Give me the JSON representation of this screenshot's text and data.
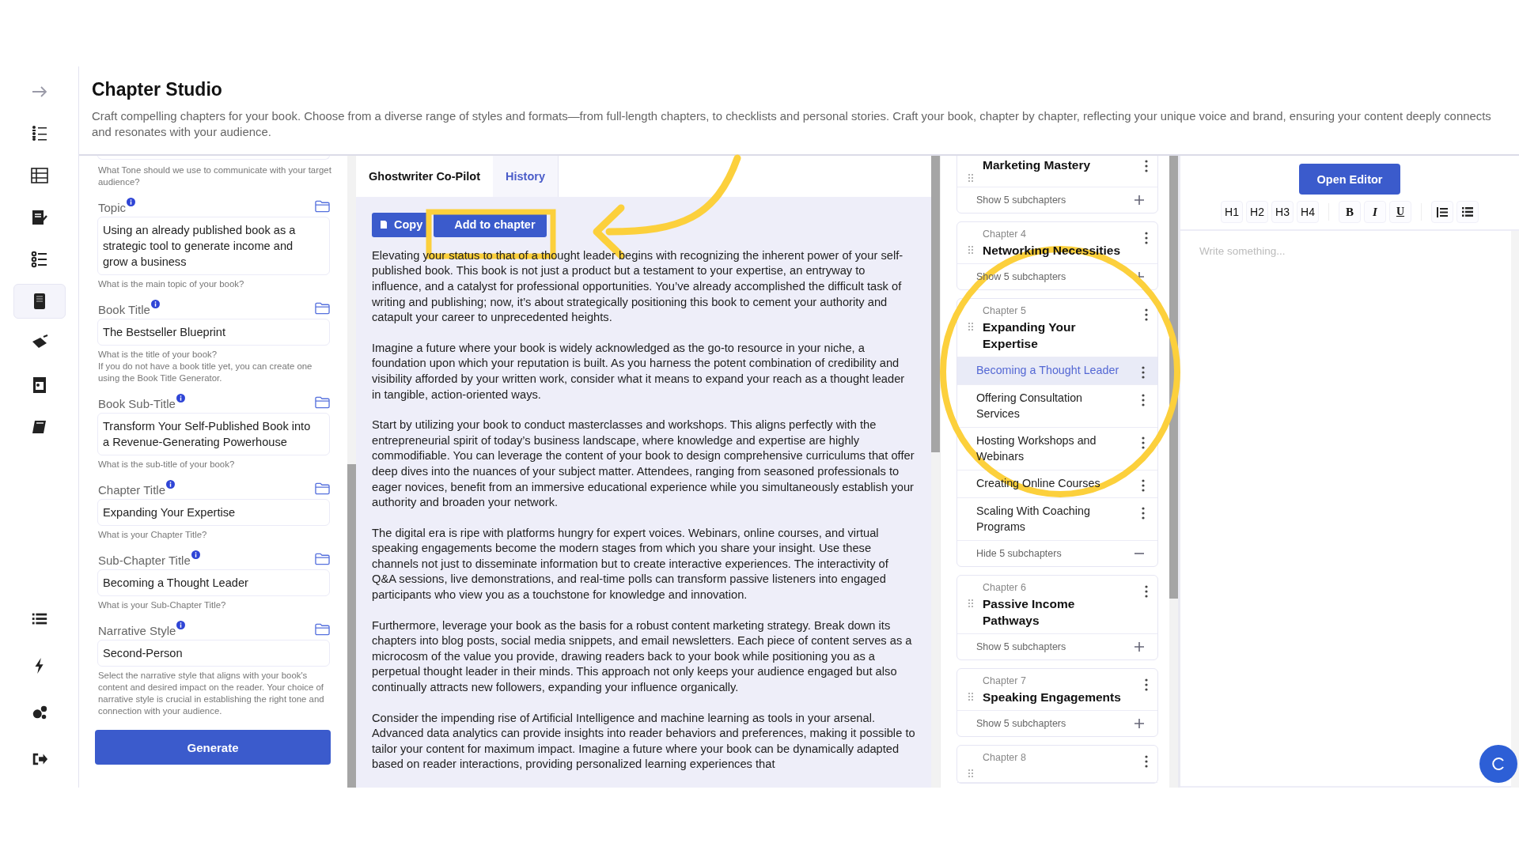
{
  "page": {
    "title": "Chapter Studio",
    "description": "Craft compelling chapters for your book. Choose from a diverse range of styles and formats—from full-length chapters, to checklists and personal stories. Craft your book, chapter by chapter, reflecting your unique voice and brand, ensuring your content deeply connects and resonates with your audience."
  },
  "nav": {
    "top": [
      {
        "selected": false
      },
      {
        "selected": false
      },
      {
        "selected": false
      },
      {
        "selected": false
      },
      {
        "selected": false
      },
      {
        "selected": true
      },
      {
        "selected": false
      },
      {
        "selected": false
      },
      {
        "selected": false
      }
    ],
    "bottom": [
      {
        "selected": false
      },
      {
        "selected": false
      },
      {
        "selected": false
      },
      {
        "selected": false
      }
    ]
  },
  "form": {
    "top_hint": "What Tone should we use to communicate with your target audience?",
    "fields": [
      {
        "label": "Topic",
        "value": "Using an already published book as a strategic tool to generate income and grow a business",
        "hint": "What is the main topic of your book?"
      },
      {
        "label": "Book Title",
        "value": "The Bestseller Blueprint",
        "hint": "What is the title of your book?\nIf you do not have a book title yet, you can create one using the Book Title Generator."
      },
      {
        "label": "Book Sub-Title",
        "value": "Transform Your Self-Published Book into a Revenue-Generating Powerhouse",
        "hint": "What is the sub-title of your book?"
      },
      {
        "label": "Chapter Title",
        "value": "Expanding Your Expertise",
        "hint": "What is your Chapter Title?"
      },
      {
        "label": "Sub-Chapter Title",
        "value": "Becoming a Thought Leader",
        "hint": "What is your Sub-Chapter Title?"
      },
      {
        "label": "Narrative Style",
        "value": "Second-Person",
        "hint": "Select the narrative style that aligns with your book's content and desired impact on the reader. Your choice of narrative style is crucial in establishing the right tone and connection with your audience."
      }
    ],
    "button": "Generate"
  },
  "copilot": {
    "tabs": [
      {
        "label": "Ghostwriter Co-Pilot",
        "selected": true
      },
      {
        "label": "History",
        "selected": false
      }
    ],
    "actions": [
      "Copy",
      "Add to chapter"
    ],
    "paragraphs": [
      "Elevating your status to that of a thought leader begins with recognizing the inherent power of your self-published book. This book is not just a product but a testament to your expertise, an entryway to influence, and a catalyst for professional opportunities. You’ve already accomplished the difficult task of writing and publishing; now, it’s about strategically positioning this book to cement your authority and catapult your career to unprecedented heights.",
      "Imagine a future where your book is widely acknowledged as the go-to resource in your niche, a foundation upon which your reputation is built. As you harness the potent combination of credibility and visibility afforded by your written work, consider what it means to expand your reach as a thought leader in tangible, action-oriented ways.",
      "Start by utilizing your book to conduct masterclasses and workshops. This aligns perfectly with the entrepreneurial spirit of today’s business landscape, where knowledge and expertise are highly commodifiable. You can leverage the content of your book to design comprehensive curriculums that offer deep dives into the nuances of your subject matter. Attendees, ranging from seasoned professionals to eager novices, benefit from an immersive educational experience while you simultaneously establish your authority and broaden your network.",
      "The digital era is ripe with platforms hungry for expert voices. Webinars, online courses, and virtual speaking engagements become the modern stages from which you share your insight. Use these channels not just to disseminate information but to create interactive experiences. The interactivity of Q&A sessions, live demonstrations, and real-time polls can transform passive listeners into engaged participants who view you as a touchstone for knowledge and innovation.",
      "Furthermore, leverage your book as the basis for a robust content marketing strategy. Break down its chapters into blog posts, social media snippets, and email newsletters. Each piece of content serves as a microcosm of the value you provide, drawing readers back to your book while positioning you as a perpetual thought leader in their minds. This approach not only keeps your audience engaged but also continually attracts new followers, expanding your influence organically.",
      "Consider the impending rise of Artificial Intelligence and machine learning as tools in your arsenal. Advanced data analytics can provide insights into reader behaviors and preferences, making it possible to tailor your content for maximum impact. Imagine a future where your book can be dynamically adapted based on reader interactions, providing personalized learning experiences that"
    ]
  },
  "chapters": [
    {
      "title": "Marketing Mastery",
      "expanded": false,
      "toggle": "Show 5 subchapters"
    },
    {
      "label": "Chapter 4",
      "title": "Networking Necessities",
      "expanded": false,
      "toggle": "Show 5 subchapters"
    },
    {
      "label": "Chapter 5",
      "title": "Expanding Your Expertise",
      "expanded": true,
      "toggle": "Hide 5 subchapters",
      "subchapters": [
        {
          "title": "Becoming a Thought Leader",
          "selected": true
        },
        {
          "title": "Offering Consultation Services",
          "selected": false
        },
        {
          "title": "Hosting Workshops and Webinars",
          "selected": false
        },
        {
          "title": "Creating Online Courses",
          "selected": false
        },
        {
          "title": "Scaling With Coaching Programs",
          "selected": false
        }
      ]
    },
    {
      "label": "Chapter 6",
      "title": "Passive Income Pathways",
      "expanded": false,
      "toggle": "Show 5 subchapters"
    },
    {
      "label": "Chapter 7",
      "title": "Speaking Engagements",
      "expanded": false,
      "toggle": "Show 5 subchapters"
    },
    {
      "label": "Chapter 8"
    }
  ],
  "editor": {
    "button": "Open Editor",
    "headings": [
      "H1",
      "H2",
      "H3",
      "H4"
    ],
    "formats": [
      "B",
      "I",
      "U"
    ],
    "placeholder": "Write something..."
  }
}
